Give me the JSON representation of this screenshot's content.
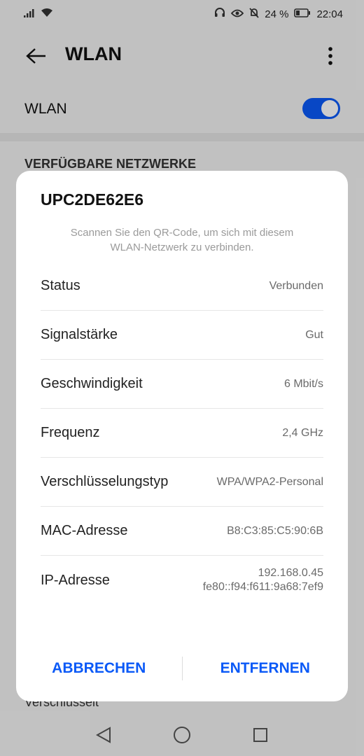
{
  "status_bar": {
    "battery_percent": "24 %",
    "time": "22:04"
  },
  "app_bar": {
    "title": "WLAN"
  },
  "wlan_toggle": {
    "label": "WLAN",
    "on": true
  },
  "section_header": "VERFÜGBARE NETZWERKE",
  "background_item_text": "Verschlüsselt",
  "dialog": {
    "title": "UPC2DE62E6",
    "hint_line1": "Scannen Sie den QR-Code, um sich mit diesem",
    "hint_line2": "WLAN-Netzwerk zu verbinden.",
    "rows": [
      {
        "label": "Status",
        "value": "Verbunden"
      },
      {
        "label": "Signalstärke",
        "value": "Gut"
      },
      {
        "label": "Geschwindigkeit",
        "value": "6 Mbit/s"
      },
      {
        "label": "Frequenz",
        "value": "2,4 GHz"
      },
      {
        "label": "Verschlüsselungstyp",
        "value": "WPA/WPA2-Personal"
      },
      {
        "label": "MAC-Adresse",
        "value": "B8:C3:85:C5:90:6B"
      },
      {
        "label": "IP-Adresse",
        "value_ipv4": "192.168.0.45",
        "value_ipv6": "fe80::f94:f611:9a68:7ef9"
      }
    ],
    "cancel_label": "ABBRECHEN",
    "remove_label": "ENTFERNEN"
  },
  "colors": {
    "accent": "#0a59f7"
  }
}
